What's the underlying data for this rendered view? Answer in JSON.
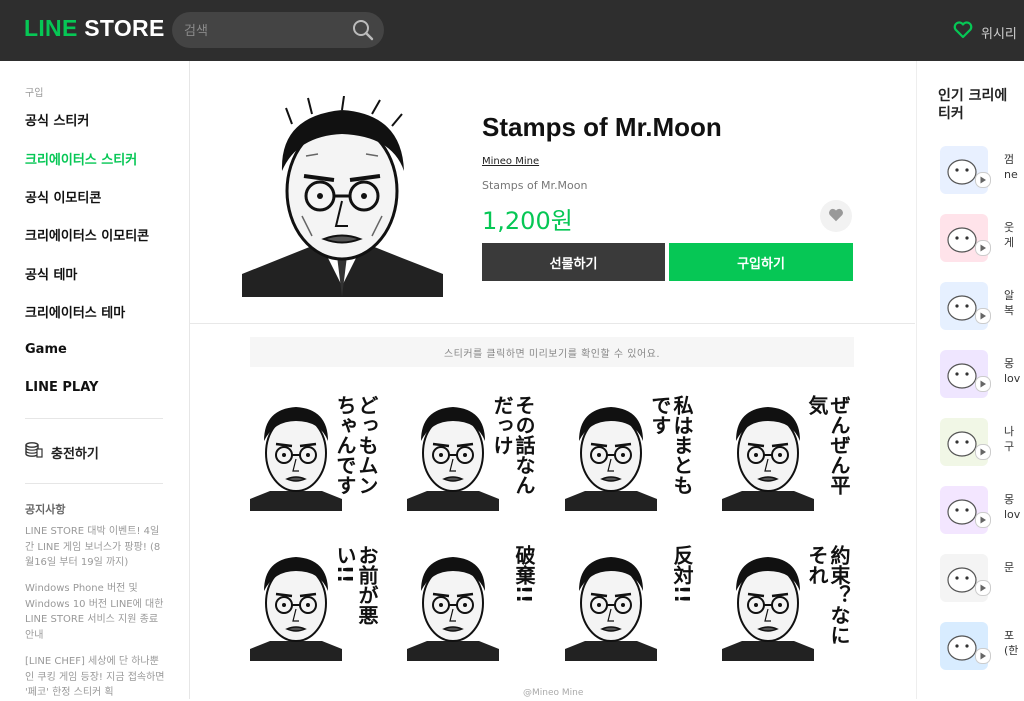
{
  "header": {
    "logo_line": "LINE",
    "logo_store": " STORE",
    "search_placeholder": "검색",
    "wishlist_label": "위시리"
  },
  "sidebar": {
    "caption": "구입",
    "items": [
      {
        "label": "공식 스티커",
        "active": false
      },
      {
        "label": "크리에이터스 스티커",
        "active": true
      },
      {
        "label": "공식 이모티콘",
        "active": false
      },
      {
        "label": "크리에이터스 이모티콘",
        "active": false
      },
      {
        "label": "공식 테마",
        "active": false
      },
      {
        "label": "크리에이터스 테마",
        "active": false
      },
      {
        "label": "Game",
        "active": false
      },
      {
        "label": "LINE PLAY",
        "active": false
      }
    ],
    "charge_label": "충전하기",
    "notice_title": "공지사항",
    "notices": [
      "LINE STORE 대박 이벤트! 4일간 LINE 게임 보너스가 팡팡! (8월16일 부터 19일 까지)",
      "Windows Phone 버전 및 Windows 10 버전 LINE에 대한 LINE STORE 서비스 지원 종료 안내",
      "[LINE CHEF] 세상에 단 하나뿐인 쿠킹 게임 등장! 지금 접속하면 '페코' 한정 스티커 획"
    ]
  },
  "product": {
    "title": "Stamps of Mr.Moon",
    "author": "Mineo Mine",
    "description": "Stamps of Mr.Moon",
    "price": "1,200원",
    "gift_label": "선물하기",
    "buy_label": "구입하기",
    "preview_hint": "스티커를 클릭하면 미리보기를 확인할 수 있어요.",
    "copyright": "@Mineo Mine"
  },
  "stickers": [
    {
      "text": "どっもムンちゃんです"
    },
    {
      "text": "その話なんだっけ"
    },
    {
      "text": "私はまともです"
    },
    {
      "text": "ぜんぜん平気"
    },
    {
      "text": "お前が悪い!!"
    },
    {
      "text": "破棄!!"
    },
    {
      "text": "反対!!"
    },
    {
      "text": "約束？なにそれ"
    }
  ],
  "popular": {
    "title": "인기 크리에이터스 스티커",
    "title_shown": "인기 크리에\n티커",
    "items": [
      {
        "name": "껌\nne"
      },
      {
        "name": "웃\n게"
      },
      {
        "name": "알\n복"
      },
      {
        "name": "몽\nlov"
      },
      {
        "name": "나\n구"
      },
      {
        "name": "몽\nlov"
      },
      {
        "name": "문"
      },
      {
        "name": "포\n(한"
      }
    ]
  },
  "colors": {
    "accent": "#06c755",
    "header_bg": "#2e2e2e"
  }
}
